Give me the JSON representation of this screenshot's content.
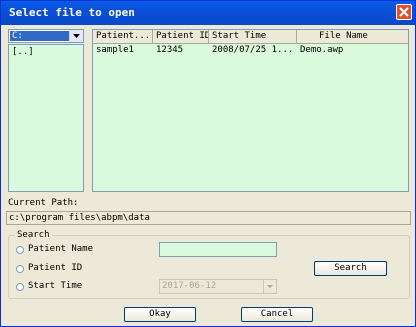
{
  "window": {
    "title": "Select file to open"
  },
  "drive": {
    "selected": "C:"
  },
  "folders": [
    "[..]"
  ],
  "table": {
    "columns": [
      "Patient...",
      "Patient ID",
      "Start Time",
      "File Name"
    ],
    "rows": [
      [
        "sample1",
        "12345",
        "2008/07/25 1...",
        "Demo.awp"
      ]
    ]
  },
  "current_path": {
    "label": "Current Path:",
    "value": "c:\\program files\\abpm\\data"
  },
  "search": {
    "group_title": "Search",
    "options": [
      "Patient Name",
      "Patient ID",
      "Start Time"
    ],
    "text_value": "",
    "date_value": "2017-06-12",
    "button_label": "Search"
  },
  "buttons": {
    "okay": "Okay",
    "cancel": "Cancel"
  },
  "colors": {
    "title_bar": "#0a5ee8",
    "list_bg": "#dafadd",
    "dialog_bg": "#ece9d8"
  }
}
